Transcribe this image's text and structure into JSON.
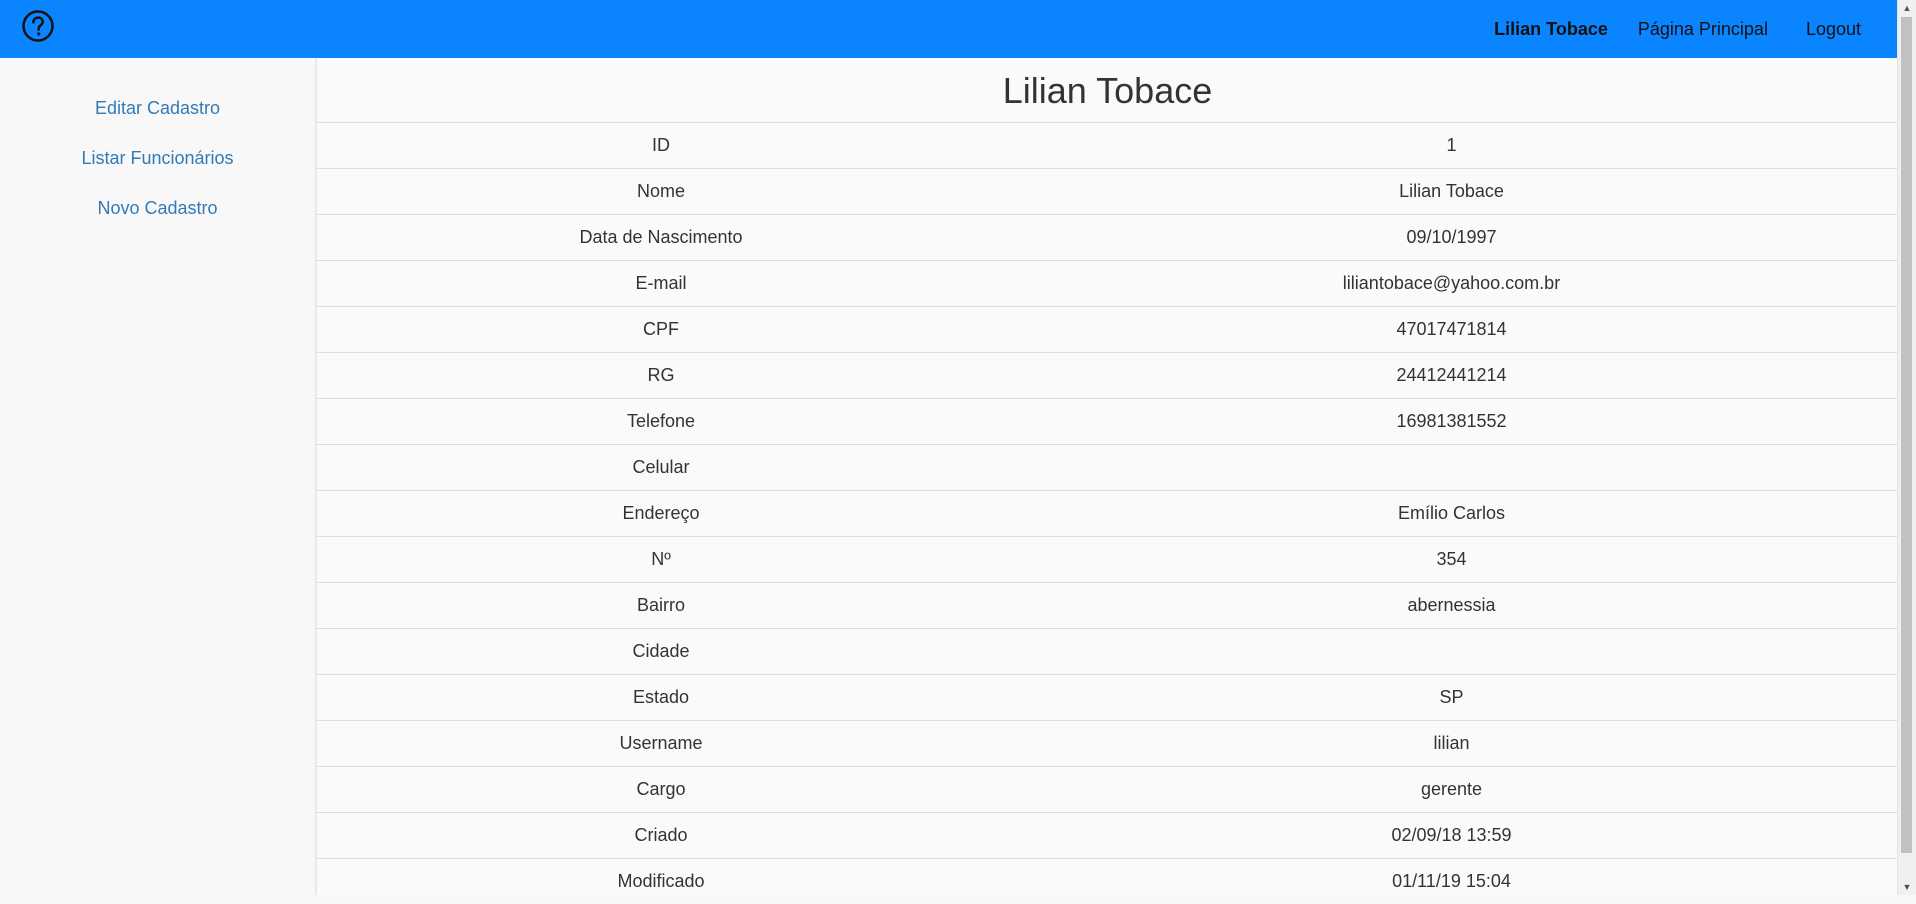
{
  "header": {
    "help_icon": "help-circle-icon",
    "user_name": "Lilian Tobace",
    "home_link": "Página Principal",
    "logout_link": "Logout",
    "background_color": "#0a84ff"
  },
  "sidebar": {
    "items": [
      {
        "label": "Editar Cadastro"
      },
      {
        "label": "Listar Funcionários"
      },
      {
        "label": "Novo Cadastro"
      }
    ],
    "link_color": "#337ab7"
  },
  "main": {
    "title": "Lilian Tobace",
    "fields": [
      {
        "label": "ID",
        "value": "1"
      },
      {
        "label": "Nome",
        "value": "Lilian Tobace"
      },
      {
        "label": "Data de Nascimento",
        "value": "09/10/1997"
      },
      {
        "label": "E-mail",
        "value": "liliantobace@yahoo.com.br"
      },
      {
        "label": "CPF",
        "value": "47017471814"
      },
      {
        "label": "RG",
        "value": "24412441214"
      },
      {
        "label": "Telefone",
        "value": "16981381552"
      },
      {
        "label": "Celular",
        "value": ""
      },
      {
        "label": "Endereço",
        "value": "Emílio Carlos"
      },
      {
        "label": "Nº",
        "value": "354"
      },
      {
        "label": "Bairro",
        "value": "abernessia"
      },
      {
        "label": "Cidade",
        "value": ""
      },
      {
        "label": "Estado",
        "value": "SP"
      },
      {
        "label": "Username",
        "value": "lilian"
      },
      {
        "label": "Cargo",
        "value": "gerente"
      },
      {
        "label": "Criado",
        "value": "02/09/18 13:59"
      },
      {
        "label": "Modificado",
        "value": "01/11/19 15:04"
      }
    ]
  },
  "scrollbar": {
    "up_arrow": "▲",
    "down_arrow": "▼"
  }
}
